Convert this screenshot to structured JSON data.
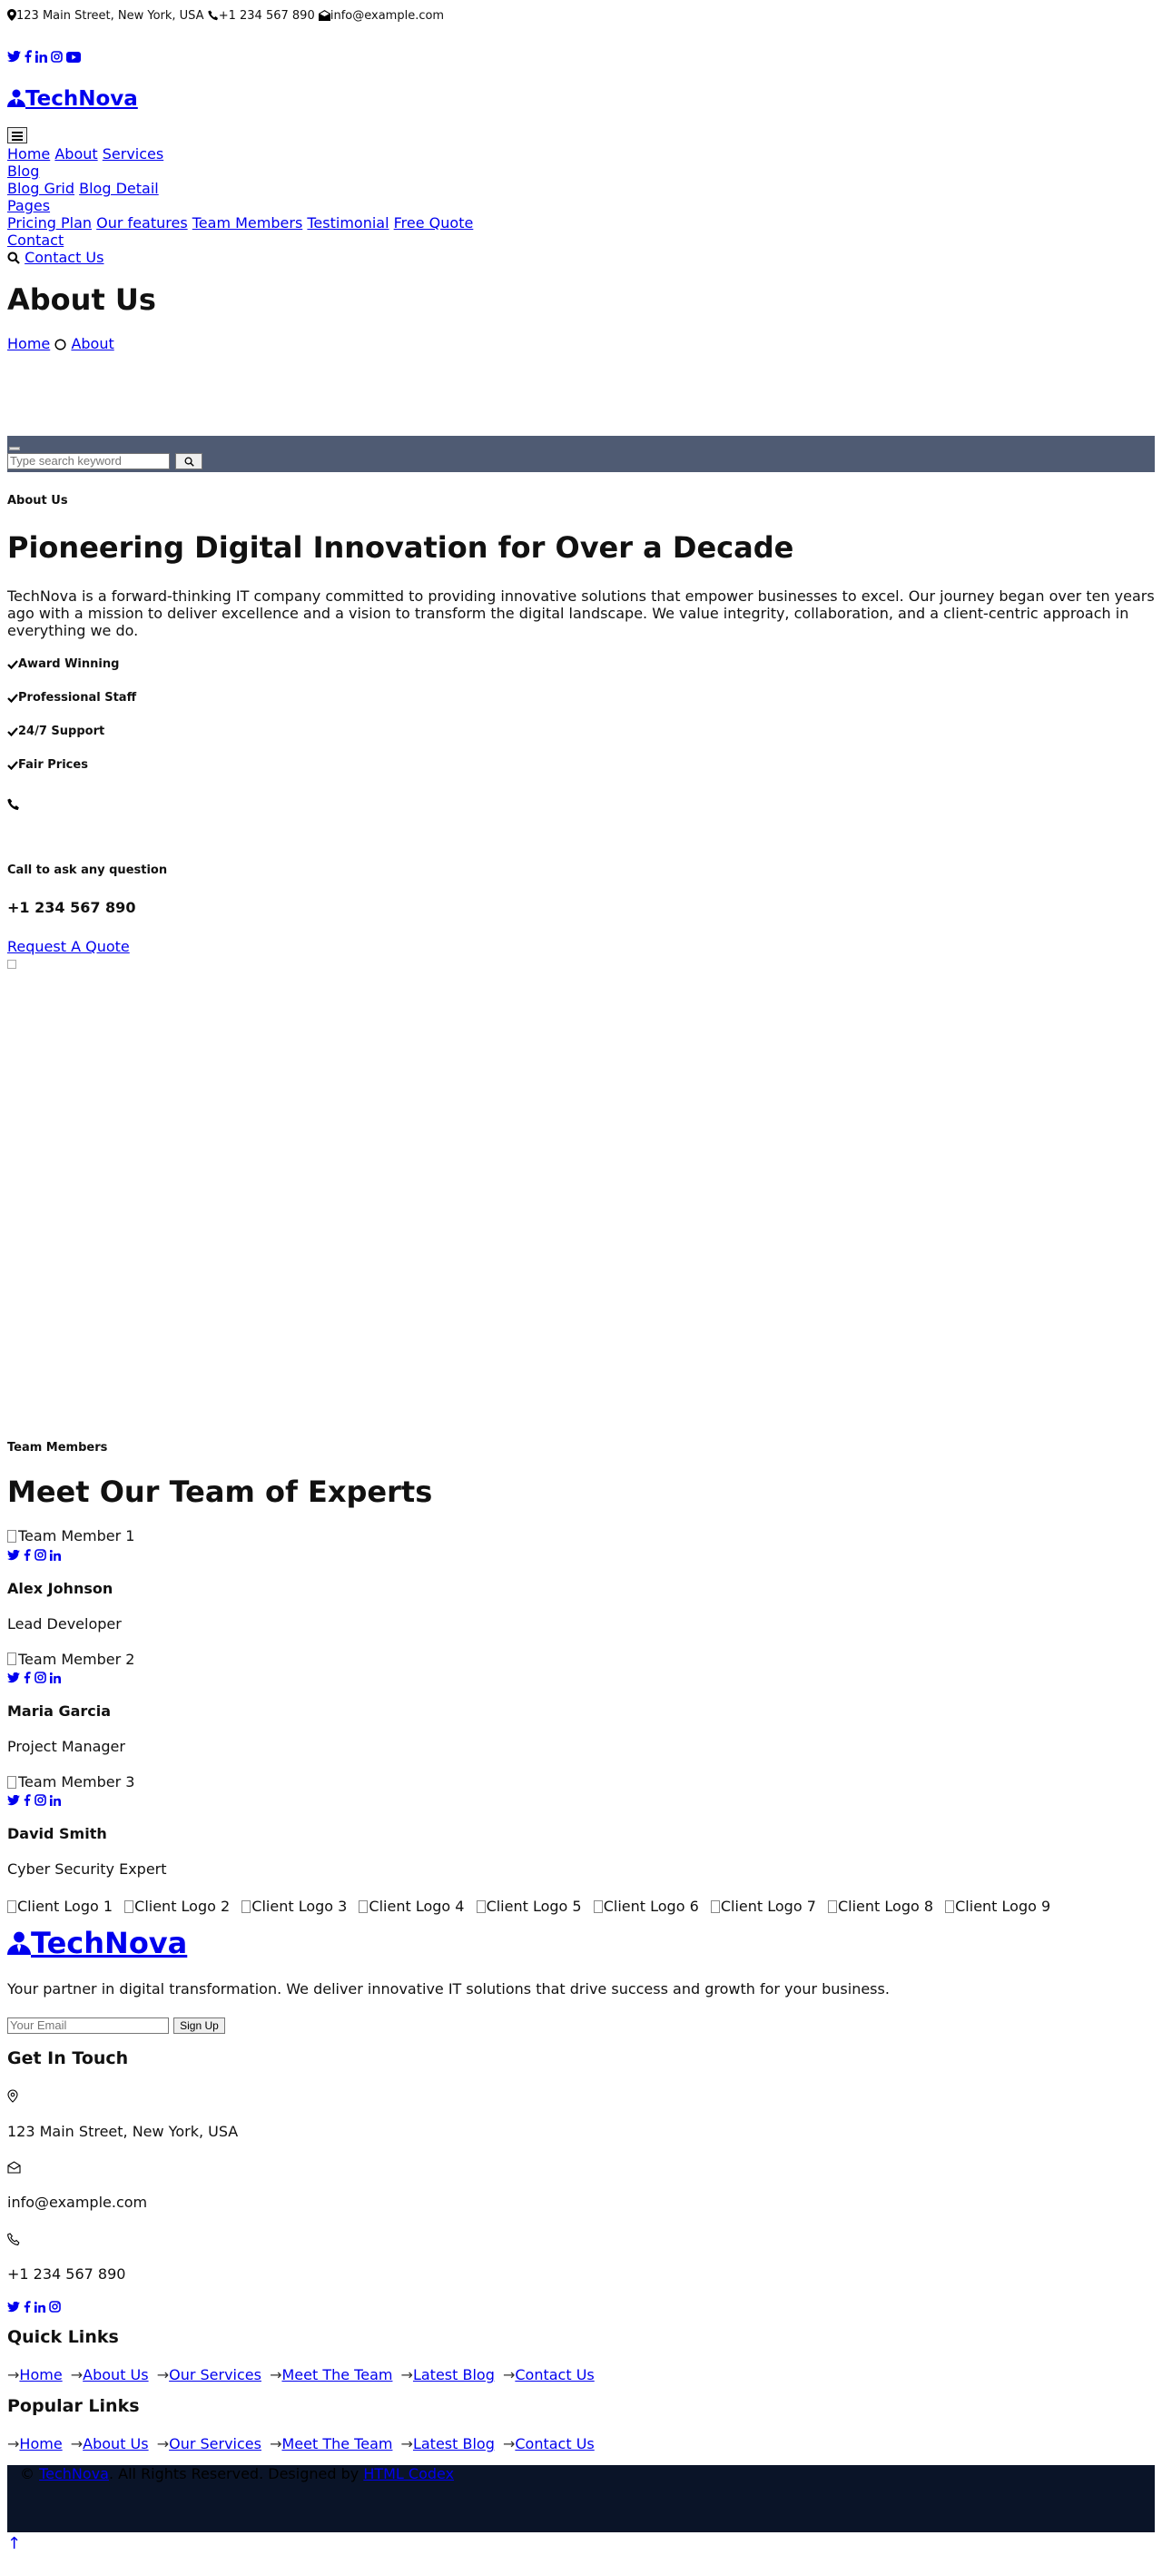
{
  "topbar": {
    "address": "123 Main Street, New York, USA",
    "phone": "+1 234 567 890",
    "email": "info@example.com"
  },
  "brand": {
    "name": "TechNova"
  },
  "nav": {
    "toggle": "≡",
    "home": "Home",
    "about": "About",
    "services": "Services",
    "blog": "Blog",
    "blog_grid": "Blog Grid",
    "blog_detail": "Blog Detail",
    "pages": "Pages",
    "pricing": "Pricing Plan",
    "features": "Our features",
    "team": "Team Members",
    "testimonial": "Testimonial",
    "free_quote": "Free Quote",
    "contact": "Contact",
    "contact_us": "Contact Us"
  },
  "page_header": {
    "title": "About Us",
    "crumb_home": "Home",
    "crumb_current": "About"
  },
  "search": {
    "placeholder": "Type search keyword"
  },
  "about": {
    "eyebrow": "About Us",
    "title": "Pioneering Digital Innovation for Over a Decade",
    "body": "TechNova is a forward-thinking IT company committed to providing innovative solutions that empower businesses to excel. Our journey began over ten years ago with a mission to deliver excellence and a vision to transform the digital landscape. We value integrity, collaboration, and a client-centric approach in everything we do.",
    "features": [
      "Award Winning",
      "Professional Staff",
      "24/7 Support",
      "Fair Prices"
    ],
    "call_label": "Call to ask any question",
    "call_number": "+1 234 567 890",
    "quote_button": "Request A Quote"
  },
  "team": {
    "eyebrow": "Team Members",
    "title": "Meet Our Team of Experts",
    "members": [
      {
        "alt": "Team Member 1",
        "name": "Alex Johnson",
        "role": "Lead Developer"
      },
      {
        "alt": "Team Member 2",
        "name": "Maria Garcia",
        "role": "Project Manager"
      },
      {
        "alt": "Team Member 3",
        "name": "David Smith",
        "role": "Cyber Security Expert"
      }
    ]
  },
  "clients": [
    "Client Logo 1",
    "Client Logo 2",
    "Client Logo 3",
    "Client Logo 4",
    "Client Logo 5",
    "Client Logo 6",
    "Client Logo 7",
    "Client Logo 8",
    "Client Logo 9"
  ],
  "footer": {
    "description": "Your partner in digital transformation. We deliver innovative IT solutions that drive success and growth for your business.",
    "email_placeholder": "Your Email",
    "signup": "Sign Up",
    "get_in_touch": "Get In Touch",
    "address": "123 Main Street, New York, USA",
    "email": "info@example.com",
    "phone": "+1 234 567 890",
    "quick_links_title": "Quick Links",
    "popular_links_title": "Popular Links",
    "links": [
      "Home",
      "About Us",
      "Our Services",
      "Meet The Team",
      "Latest Blog",
      "Contact Us"
    ],
    "copyright_brand": "TechNova",
    "copyright_text": ". All Rights Reserved. Designed by",
    "designer": "HTML Codex",
    "back_to_top": "↑"
  },
  "colors": {
    "link": "#0000ee",
    "search_band": "#4f5b73",
    "copyright_band": "#0a1428"
  }
}
